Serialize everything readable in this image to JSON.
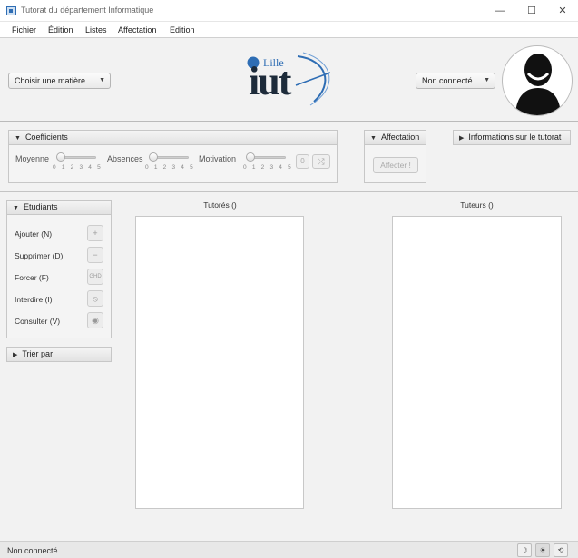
{
  "window": {
    "title": "Tutorat du département Informatique",
    "controls": {
      "minimize": "—",
      "maximize": "☐",
      "close": "✕"
    }
  },
  "menu": [
    "Fichier",
    "Édition",
    "Listes",
    "Affectation",
    "Edition"
  ],
  "header": {
    "subject_select": {
      "value": "Choisir une matière"
    },
    "logo": {
      "small_text": "Lille",
      "big_text": "iut"
    },
    "connection_select": {
      "value": "Non connecté"
    },
    "avatar": "user-silhouette-icon"
  },
  "coefficients": {
    "title": "Coefficients",
    "sliders": [
      {
        "label": "Moyenne",
        "ticks": "0 1 2 3 4 5",
        "value": 0
      },
      {
        "label": "Absences",
        "ticks": "0 1 2 3 4 5",
        "value": 0
      },
      {
        "label": "Motivation",
        "ticks": "0 1 2 3 4 5",
        "value": 0
      }
    ],
    "value_button": "0",
    "shuffle_icon": "shuffle-icon"
  },
  "affectation": {
    "title": "Affectation",
    "button": "Affecter !"
  },
  "info": {
    "title": "Informations sur le tutorat"
  },
  "etudiants": {
    "title": "Etudiants",
    "actions": [
      {
        "label": "Ajouter (N)",
        "icon": "+"
      },
      {
        "label": "Supprimer (D)",
        "icon": "−"
      },
      {
        "label": "Forcer (F)",
        "icon": "GHD"
      },
      {
        "label": "Interdire (I)",
        "icon": "⦸"
      },
      {
        "label": "Consulter (V)",
        "icon": "◉"
      }
    ]
  },
  "sort": {
    "title": "Trier par"
  },
  "lists": {
    "tutores_title": "Tutorés ()",
    "tuteurs_title": "Tuteurs ()"
  },
  "status": {
    "text": "Non connecté",
    "buttons": [
      "☽",
      "☀",
      "⟲"
    ]
  },
  "colors": {
    "accent": "#2e6db4",
    "logo_dark": "#1d2b3a"
  }
}
